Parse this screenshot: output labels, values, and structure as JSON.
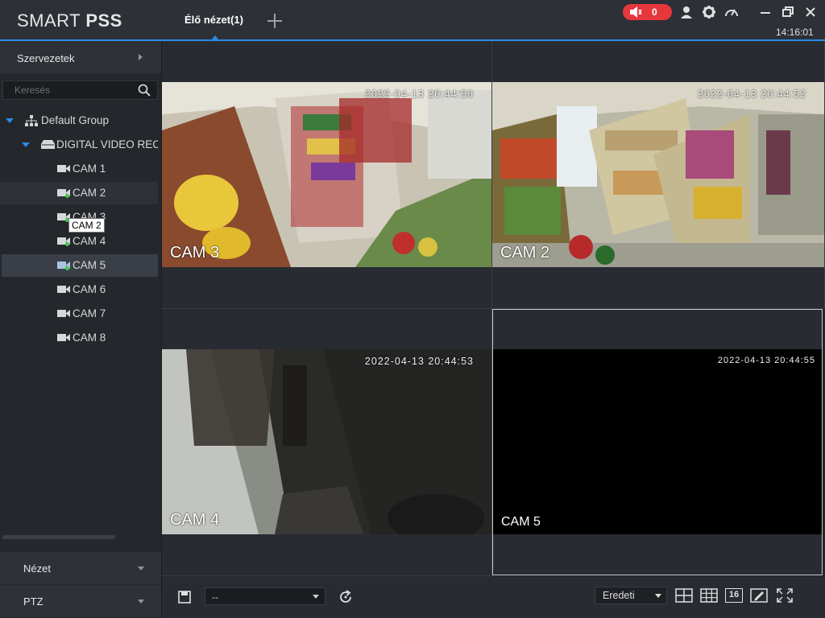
{
  "app": {
    "logo_light": "SMART ",
    "logo_bold": "PSS",
    "tab_live": "Élő nézet(1)",
    "alarm_count": "0",
    "clock": "14:16:01",
    "accent_color": "#2b8ae6",
    "alarm_color": "#e5373c"
  },
  "sidebar": {
    "organizations_label": "Szervezetek",
    "search_placeholder": "Keresés",
    "tree": {
      "group_label": "Default Group",
      "device_label": "DIGITAL VIDEO RECORDER",
      "cameras": [
        {
          "label": "CAM 1",
          "online": false
        },
        {
          "label": "CAM 2",
          "online": true
        },
        {
          "label": "CAM 3",
          "online": true
        },
        {
          "label": "CAM 4",
          "online": true
        },
        {
          "label": "CAM 5",
          "online": true
        },
        {
          "label": "CAM 6",
          "online": false
        },
        {
          "label": "CAM 7",
          "online": false
        },
        {
          "label": "CAM 8",
          "online": false
        }
      ],
      "selected": "CAM 5",
      "hovered": "CAM 2"
    },
    "tooltip_text": "CAM 2",
    "view_label": "Nézet",
    "ptz_label": "PTZ"
  },
  "video": {
    "panes": [
      {
        "label": "CAM 3",
        "timestamp": "2022-04-13 20:44:50"
      },
      {
        "label": "CAM 2",
        "timestamp": "2022-04-13 20:44:52"
      },
      {
        "label": "CAM 4",
        "timestamp": "2022-04-13 20:44:53"
      },
      {
        "label": "CAM 5",
        "timestamp": "2022-04-13 20:44:55"
      }
    ]
  },
  "toolbar": {
    "preset_value": "--",
    "ratio_value": "Eredeti",
    "layout_16_label": "16"
  }
}
